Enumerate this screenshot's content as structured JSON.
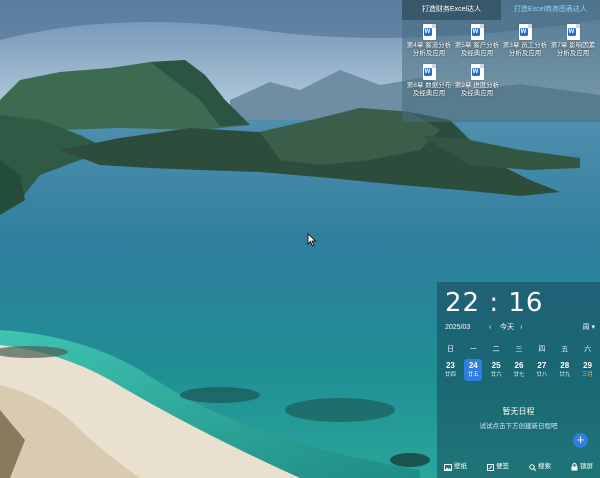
{
  "file_panel": {
    "tabs": [
      {
        "label": "打造财务Excel达人",
        "active": true
      },
      {
        "label": "打造Excel商务图表达人",
        "active": false
      }
    ],
    "files": [
      {
        "name": "第4章 客流分析分析及应用",
        "icon": "word-doc-icon"
      },
      {
        "name": "第5章 客户分析及经典应用",
        "icon": "word-doc-icon"
      },
      {
        "name": "第3章 员工分析分析及应用",
        "icon": "word-doc-icon"
      },
      {
        "name": "第7章 影响因素分析及应用",
        "icon": "word-doc-icon"
      },
      {
        "name": "第8章 数据分布及经典应用",
        "icon": "word-doc-icon"
      },
      {
        "name": "第9章 进度分析及经典应用",
        "icon": "word-doc-icon"
      }
    ]
  },
  "calendar": {
    "time": {
      "hour": "22",
      "minute": "16"
    },
    "month_label": "2025/03",
    "today_label": "今天",
    "view_label": "周",
    "weekdays": [
      "日",
      "一",
      "二",
      "三",
      "四",
      "五",
      "六"
    ],
    "days": [
      {
        "num": "23",
        "lunar": "廿四",
        "selected": false,
        "holiday": false
      },
      {
        "num": "24",
        "lunar": "廿五",
        "selected": true,
        "holiday": false
      },
      {
        "num": "25",
        "lunar": "廿六",
        "selected": false,
        "holiday": false
      },
      {
        "num": "26",
        "lunar": "廿七",
        "selected": false,
        "holiday": false
      },
      {
        "num": "27",
        "lunar": "廿八",
        "selected": false,
        "holiday": false
      },
      {
        "num": "28",
        "lunar": "廿九",
        "selected": false,
        "holiday": false
      },
      {
        "num": "29",
        "lunar": "三月",
        "selected": false,
        "holiday": true
      }
    ],
    "no_events_title": "暂无日程",
    "no_events_hint": "试试点击下方创建新日程吧",
    "add_label": "+",
    "accent_color": "#2f7fe0",
    "bottom_bar": [
      {
        "label": "壁纸",
        "icon": "wallpaper-icon"
      },
      {
        "label": "便签",
        "icon": "note-icon"
      },
      {
        "label": "搜索",
        "icon": "search-icon"
      },
      {
        "label": "锁屏",
        "icon": "lock-icon"
      }
    ]
  }
}
